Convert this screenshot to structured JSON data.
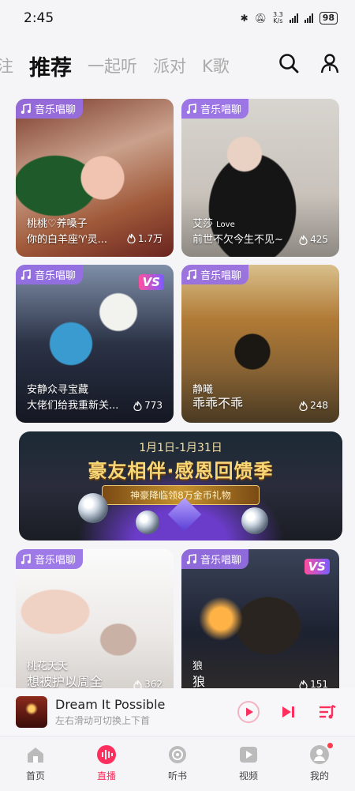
{
  "status": {
    "time": "2:45",
    "net_speed_top": "3.3",
    "net_speed_unit": "K/s",
    "battery": "98"
  },
  "tabs": [
    {
      "label": "注"
    },
    {
      "label": "推荐"
    },
    {
      "label": "一起听"
    },
    {
      "label": "派对"
    },
    {
      "label": "K歌"
    }
  ],
  "cards": [
    {
      "tag": "音乐唱聊",
      "owner": "桃桃♡养嗓子",
      "title": "你的白羊座♈灵...",
      "count": "1.7万"
    },
    {
      "tag": "音乐唱聊",
      "owner": "艾莎",
      "owner_suffix": "Love",
      "title": "前世不欠今生不见~",
      "count": "425"
    },
    {
      "tag": "音乐唱聊",
      "owner": "安静众寻宝藏",
      "title": "大佬们给我重新关...",
      "count": "773",
      "badge": "VS"
    },
    {
      "tag": "音乐唱聊",
      "owner": "静曦",
      "title": "乖乖不乖",
      "count": "248"
    },
    {
      "tag": "音乐唱聊",
      "owner": "桃花夭夭",
      "title": "想被护以周全",
      "count": "362"
    },
    {
      "tag": "音乐唱聊",
      "owner": "狼",
      "title": "狼",
      "count": "151",
      "badge": "VS"
    }
  ],
  "banner": {
    "date": "1月1日-1月31日",
    "title": "豪友相伴·感恩回馈季",
    "sub": "神豪降临领8万金币礼物"
  },
  "player": {
    "title": "Dream It Possible",
    "subtitle": "左右滑动可切换上下首"
  },
  "bottom_nav": [
    {
      "label": "首页",
      "icon": "home-icon"
    },
    {
      "label": "直播",
      "icon": "live-icon"
    },
    {
      "label": "听书",
      "icon": "audiobook-icon"
    },
    {
      "label": "视频",
      "icon": "video-icon"
    },
    {
      "label": "我的",
      "icon": "profile-icon"
    }
  ],
  "colors": {
    "accent": "#ff2f5d",
    "tag": "#966ee6"
  }
}
